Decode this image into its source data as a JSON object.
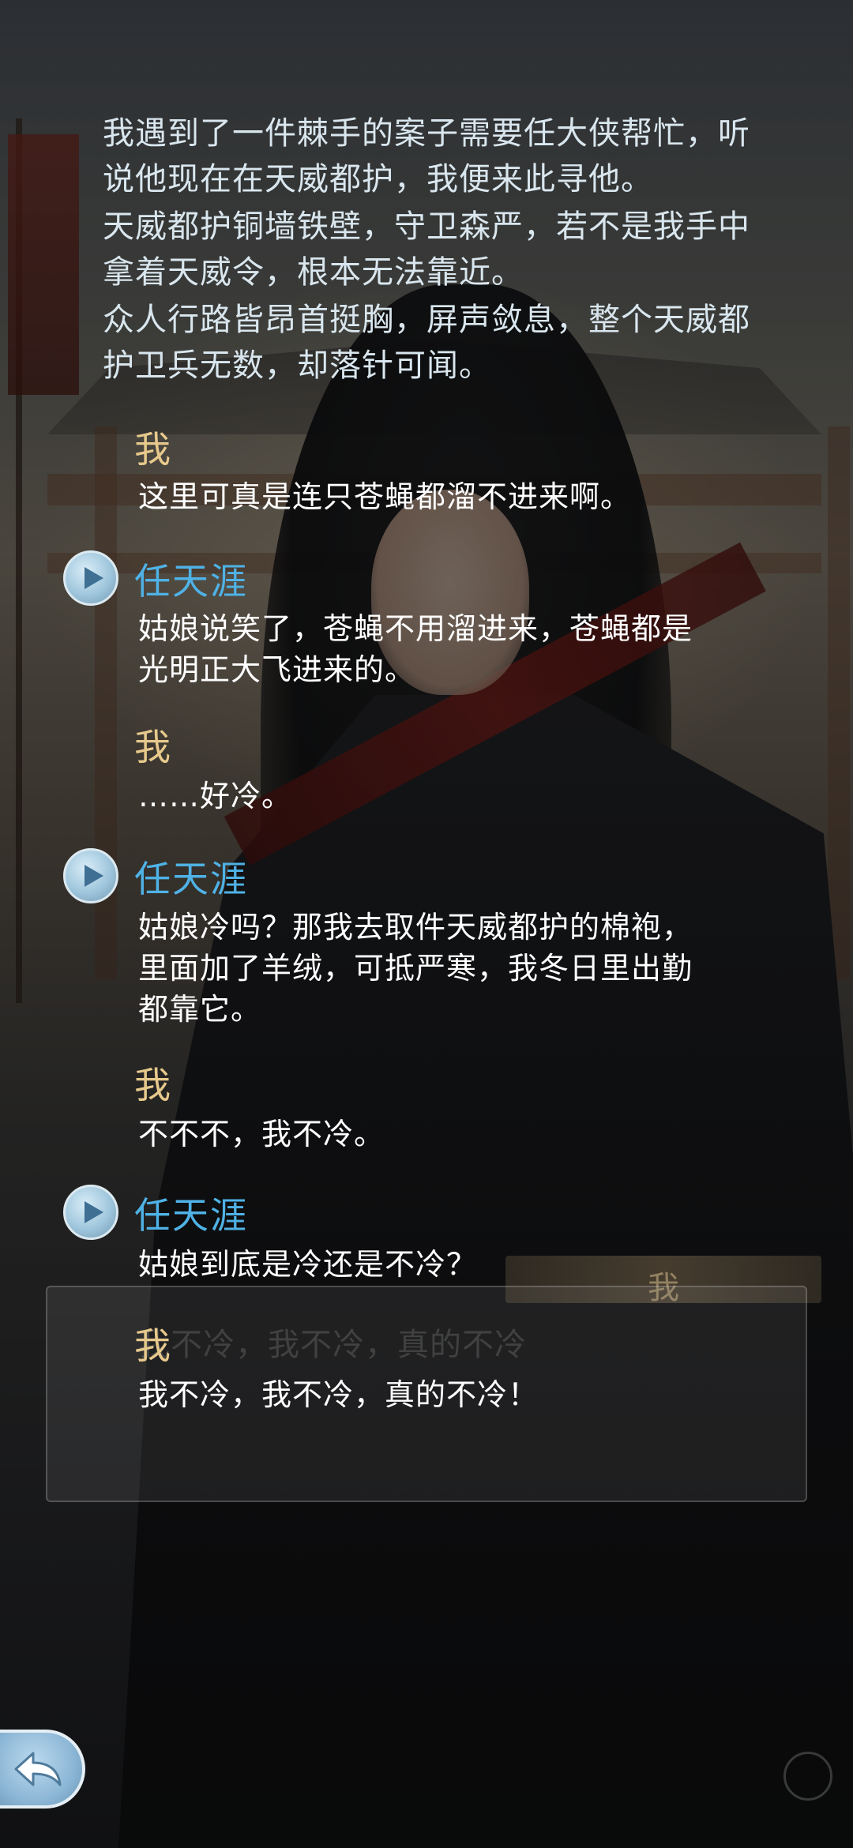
{
  "narration": [
    "我遇到了一件棘手的案子需要任大侠帮忙，听说他现在在天威都护，我便来此寻他。",
    "天威都护铜墙铁壁，守卫森严，若不是我手中拿着天威令，根本无法靠近。",
    "众人行路皆昂首挺胸，屏声敛息，整个天威都护卫兵无数，却落针可闻。"
  ],
  "dialogue": [
    {
      "speaker": "我",
      "text": "这里可真是连只苍蝇都溜不进来啊。"
    },
    {
      "speaker": "任天涯",
      "text": "姑娘说笑了，苍蝇不用溜进来，苍蝇都是光明正大飞进来的。"
    },
    {
      "speaker": "我",
      "text": "……好冷。"
    },
    {
      "speaker": "任天涯",
      "text": "姑娘冷吗？那我去取件天威都护的棉袍，里面加了羊绒，可抵严寒，我冬日里出勤都靠它。"
    },
    {
      "speaker": "我",
      "text": "不不不，我不冷。"
    },
    {
      "speaker": "任天涯",
      "text": "姑娘到底是冷还是不冷？"
    },
    {
      "speaker": "我",
      "text": "我不冷，我不冷，真的不冷！"
    }
  ],
  "ghost_dialog": {
    "speaker": "我",
    "text": "我不冷，我不冷，真的不冷"
  },
  "colors": {
    "narration": "#d9e6ee",
    "player_speaker": "#e7c98c",
    "npc_speaker": "#4fb2e6",
    "line_text": "#ffffff"
  },
  "icons": {
    "voice_replay": "play-icon",
    "back": "return-arrow-icon"
  }
}
